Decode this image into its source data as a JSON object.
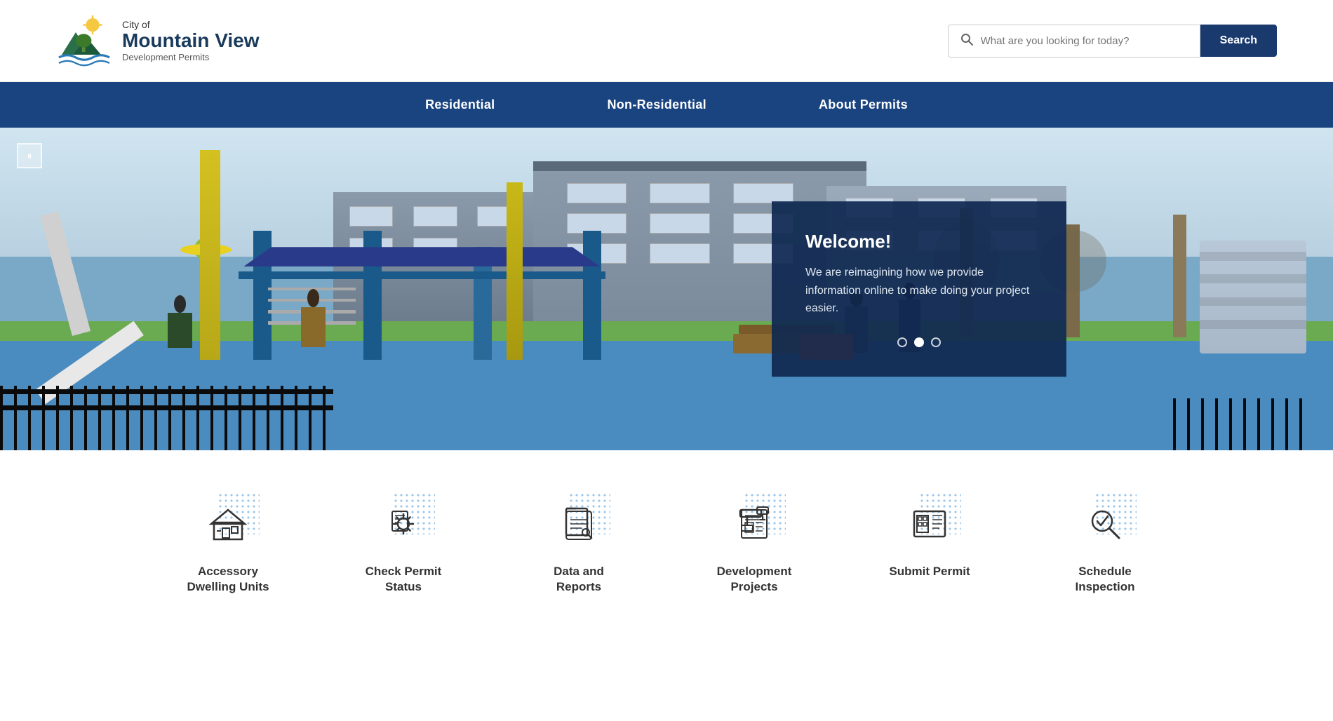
{
  "header": {
    "city_prefix": "City of",
    "city_name": "Mountain View",
    "city_sub": "Development Permits",
    "search_placeholder": "What are you looking for today?",
    "search_button": "Search"
  },
  "nav": {
    "items": [
      {
        "label": "Residential",
        "id": "residential"
      },
      {
        "label": "Non-Residential",
        "id": "non-residential"
      },
      {
        "label": "About Permits",
        "id": "about-permits"
      }
    ]
  },
  "hero": {
    "pause_icon": "⏸",
    "welcome_title": "Welcome!",
    "welcome_text": "We are reimagining how we provide information online to make doing your project easier.",
    "dots": [
      {
        "active": false,
        "index": 0
      },
      {
        "active": true,
        "index": 1
      },
      {
        "active": false,
        "index": 2
      }
    ]
  },
  "quick_links": [
    {
      "id": "accessory-dwelling",
      "label": "Accessory\nDwelling Units",
      "icon": "house"
    },
    {
      "id": "check-permit",
      "label": "Check Permit\nStatus",
      "icon": "gear"
    },
    {
      "id": "data-reports",
      "label": "Data and\nReports",
      "icon": "document"
    },
    {
      "id": "development-projects",
      "label": "Development\nProjects",
      "icon": "blueprint"
    },
    {
      "id": "submit-permit",
      "label": "Submit Permit",
      "icon": "submit"
    },
    {
      "id": "schedule-inspection",
      "label": "Schedule\nInspection",
      "icon": "magnify"
    }
  ]
}
